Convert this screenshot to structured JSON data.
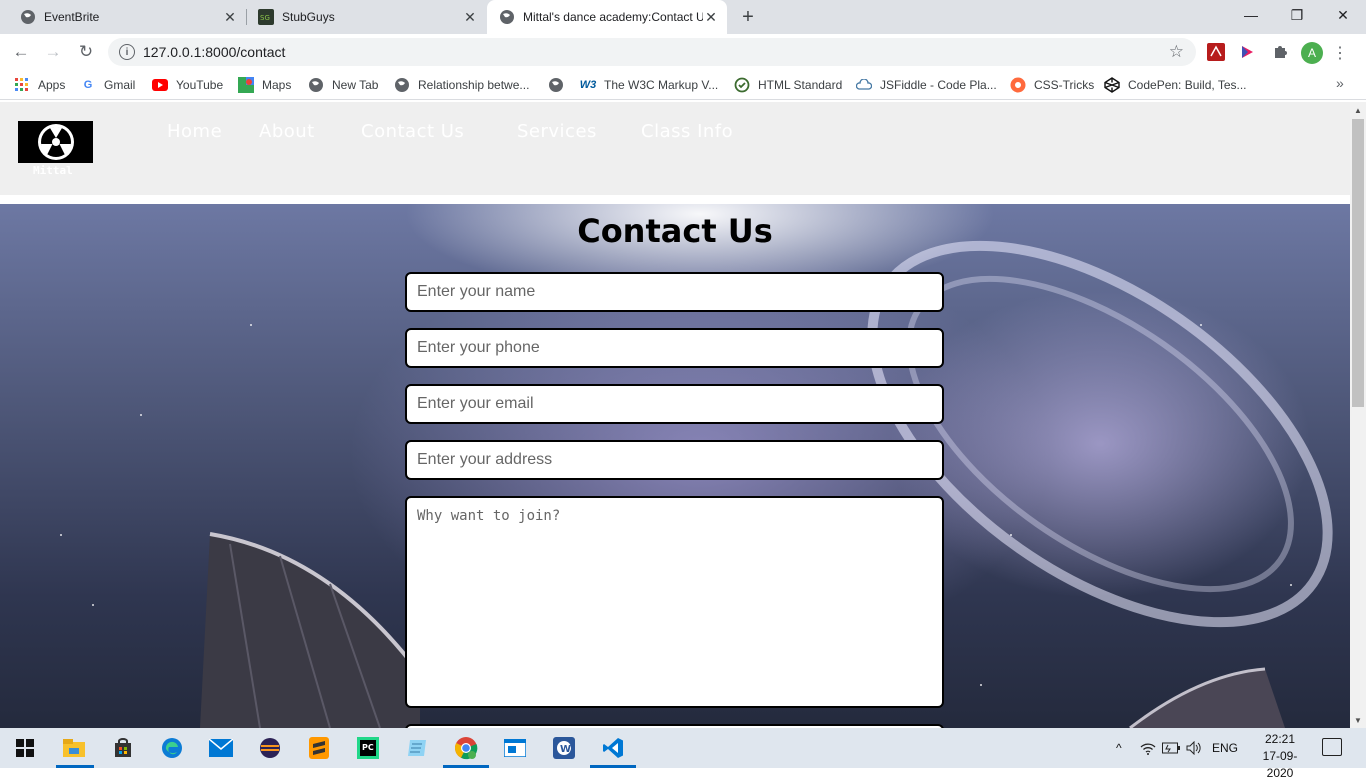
{
  "browser": {
    "tabs": [
      {
        "title": "EventBrite",
        "icon": "globe-icon",
        "active": false
      },
      {
        "title": "StubGuys",
        "icon": "stubguys-icon",
        "active": false
      },
      {
        "title": "Mittal's dance academy:Contact U",
        "icon": "globe-icon",
        "active": true
      }
    ],
    "new_tab_label": "+",
    "address": "127.0.0.1:8000/contact",
    "bookmarks": [
      {
        "label": "Apps",
        "icon": "apps-grid-icon"
      },
      {
        "label": "Gmail",
        "icon": "google-icon"
      },
      {
        "label": "YouTube",
        "icon": "youtube-icon"
      },
      {
        "label": "Maps",
        "icon": "maps-icon"
      },
      {
        "label": "New Tab",
        "icon": "globe-icon"
      },
      {
        "label": "Relationship betwe...",
        "icon": "globe-icon"
      },
      {
        "label": "",
        "icon": "globe-icon"
      },
      {
        "label": "The W3C Markup V...",
        "icon": "w3c-icon"
      },
      {
        "label": "HTML Standard",
        "icon": "whatwg-icon"
      },
      {
        "label": "JSFiddle - Code Pla...",
        "icon": "jsfiddle-icon"
      },
      {
        "label": "CSS-Tricks",
        "icon": "css-tricks-icon"
      },
      {
        "label": "CodePen: Build, Tes...",
        "icon": "codepen-icon"
      }
    ],
    "profile_initial": "A",
    "w3_text": "W3",
    "page_logo_text": "Mittal"
  },
  "site": {
    "nav": [
      "Home",
      "About",
      "Contact Us",
      "Services",
      "Class Info"
    ],
    "heading": "Contact Us",
    "form": {
      "name_placeholder": "Enter your name",
      "phone_placeholder": "Enter your phone",
      "email_placeholder": "Enter your email",
      "address_placeholder": "Enter your address",
      "why_placeholder": "Why want to join?"
    }
  },
  "taskbar": {
    "apps": [
      "windows-start-icon",
      "file-explorer-icon",
      "store-icon",
      "edge-icon",
      "mail-icon",
      "eclipse-icon",
      "sublime-icon",
      "pycharm-icon",
      "notepad-icon",
      "chrome-icon",
      "app-window-icon",
      "wps-icon",
      "vscode-icon"
    ],
    "language": "ENG",
    "time": "22:21",
    "date": "17-09-2020"
  },
  "colors": {
    "tabstrip": "#dee1e6",
    "taskbar": "#dfe6ee",
    "accent": "#0067c0"
  }
}
